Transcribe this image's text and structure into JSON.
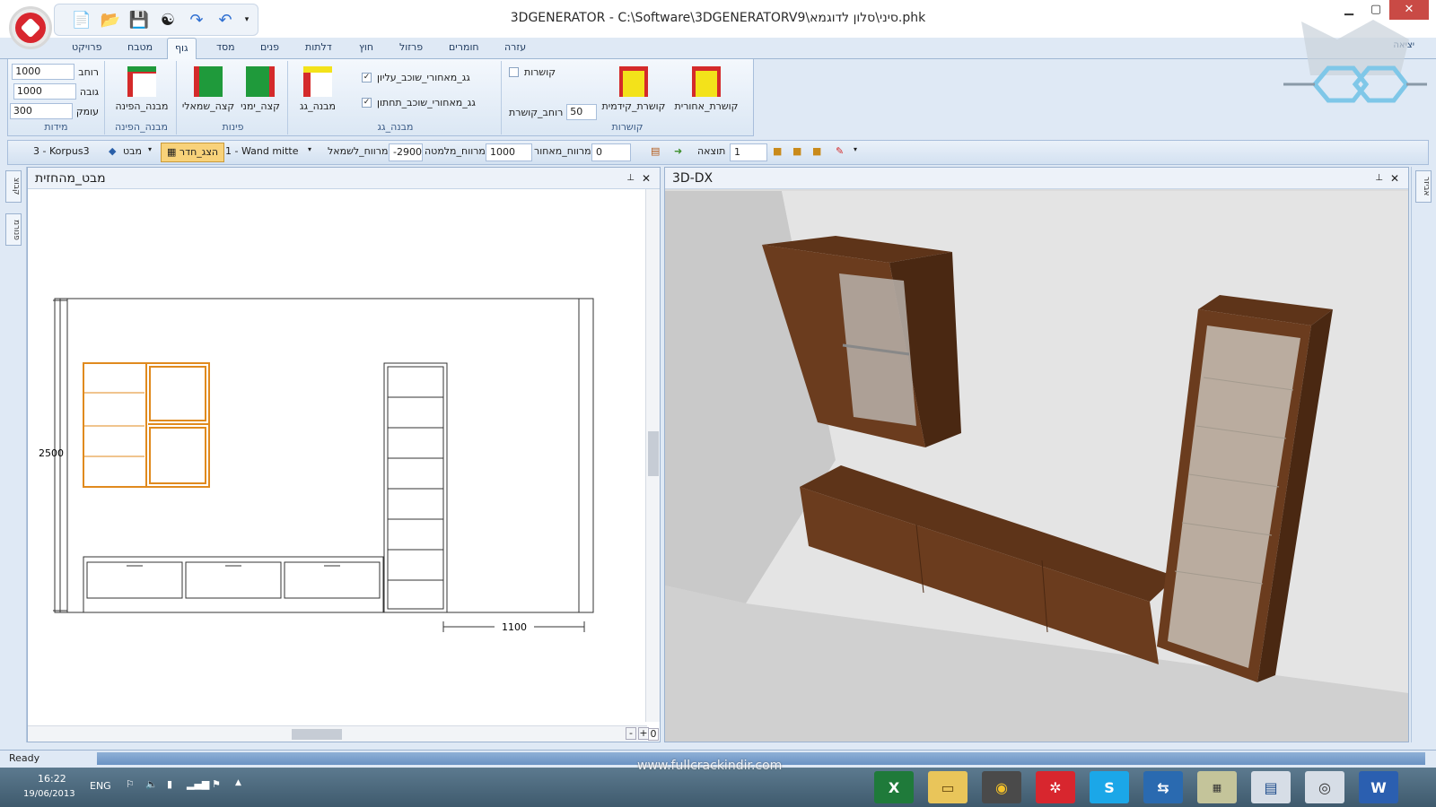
{
  "app": {
    "title": "3DGENERATOR  -  C:\\Software\\3DGENERATORV9\\סיני\\סלון לדוגמא.phk"
  },
  "window": {
    "minimize": "▁",
    "maximize": "▢",
    "close": "✕"
  },
  "ribbon_tabs": [
    "פרויקט",
    "מטבח",
    "גוף",
    "מסד",
    "פנים",
    "דלתות",
    "חוץ",
    "פרזול",
    "חומרים",
    "עזרה"
  ],
  "active_tab": "גוף",
  "exit_label": "יציאה",
  "ribbon": {
    "dimensions": {
      "label": "מידות",
      "width_label": "רוחב",
      "width": "1000",
      "height_label": "גובה",
      "height": "1000",
      "depth_label": "עומק",
      "depth": "300"
    },
    "corner_structure": {
      "label": "מבנה_הפינה",
      "button": "מבנה_הפינה"
    },
    "corners": {
      "label": "פינות",
      "left": "קצה_שמאלי",
      "right": "קצה_ימני"
    },
    "roof": {
      "label": "מבנה_גג",
      "button": "מבנה_גג",
      "top_check": "גג_מאחורי_שוכב_עליון",
      "bottom_check": "גג_מאחורי_שוכב_תחתון"
    },
    "connectors": {
      "label": "קושרות",
      "check": "קושרות",
      "width_label": "רוחב_קושרת",
      "width": "50",
      "front": "קושרת_קידמית",
      "back": "קושרת_אחורית"
    }
  },
  "toolbar": {
    "korpus": "3 - Korpus3",
    "view": "מבט",
    "room_button": "הצג_חדר",
    "wall": "1  -  Wand mitte",
    "left_label": "מרווח_לשמאל",
    "left_value": "-2900",
    "bottom_label": "מרווח_מלמטה",
    "bottom_value": "1000",
    "back_label": "מרווח_מאחור",
    "back_value": "0",
    "result_label": "תוצאה",
    "result_value": "1"
  },
  "left_panel": {
    "title": "מבט_מהחזית",
    "dim_height": "2500",
    "dim_width": "1100",
    "pin": "📌",
    "close": "✕"
  },
  "right_panel": {
    "title": "3D-DX",
    "pin": "📌",
    "close": "✕"
  },
  "side_tabs": [
    "קבוצ",
    "פנורמ"
  ],
  "right_side_tab": "אביזר",
  "scroll_zoom": [
    "-",
    "+",
    "0"
  ],
  "status": "Ready",
  "taskbar": {
    "time": "16:22",
    "date": "19/06/2013",
    "lang": "ENG"
  },
  "watermark": "www.fullcrackindir.com"
}
